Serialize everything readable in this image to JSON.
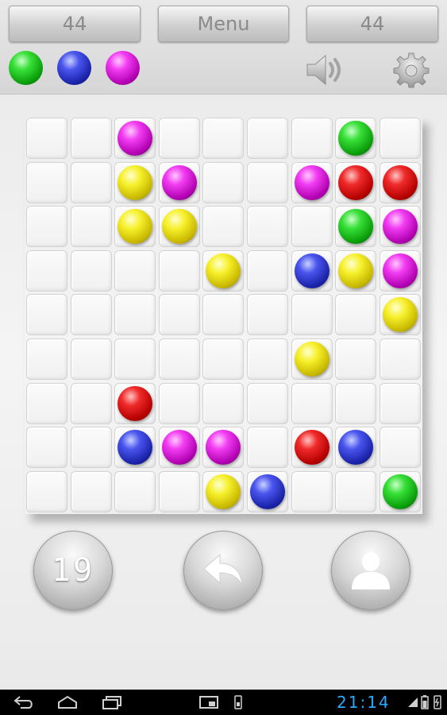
{
  "header": {
    "score_left": "44",
    "menu_label": "Menu",
    "score_right": "44",
    "next_balls": [
      "green",
      "blue",
      "magenta"
    ]
  },
  "colors": {
    "green": "#1ec21e",
    "blue": "#2a33cc",
    "magenta": "#d81ad8",
    "yellow": "#eadf10",
    "red": "#d90c0c"
  },
  "board": {
    "rows": [
      [
        "",
        "",
        "magenta",
        "",
        "",
        "",
        "",
        "green",
        ""
      ],
      [
        "",
        "",
        "yellow",
        "magenta",
        "",
        "",
        "magenta",
        "red",
        "red"
      ],
      [
        "",
        "",
        "yellow",
        "yellow",
        "",
        "",
        "",
        "green",
        "magenta"
      ],
      [
        "",
        "",
        "",
        "",
        "yellow",
        "",
        "blue",
        "yellow",
        "magenta"
      ],
      [
        "",
        "",
        "",
        "",
        "",
        "",
        "",
        "",
        "yellow"
      ],
      [
        "",
        "",
        "",
        "",
        "",
        "",
        "yellow",
        "",
        ""
      ],
      [
        "",
        "",
        "red",
        "",
        "",
        "",
        "",
        "",
        ""
      ],
      [
        "",
        "",
        "blue",
        "magenta",
        "magenta",
        "",
        "red",
        "blue",
        ""
      ],
      [
        "",
        "",
        "",
        "",
        "yellow",
        "blue",
        "",
        "",
        "green"
      ]
    ]
  },
  "controls": {
    "moves_label": "19",
    "undo_icon": "undo-arrow-icon",
    "profile_icon": "user-icon"
  },
  "statusbar": {
    "clock": "21:14"
  }
}
